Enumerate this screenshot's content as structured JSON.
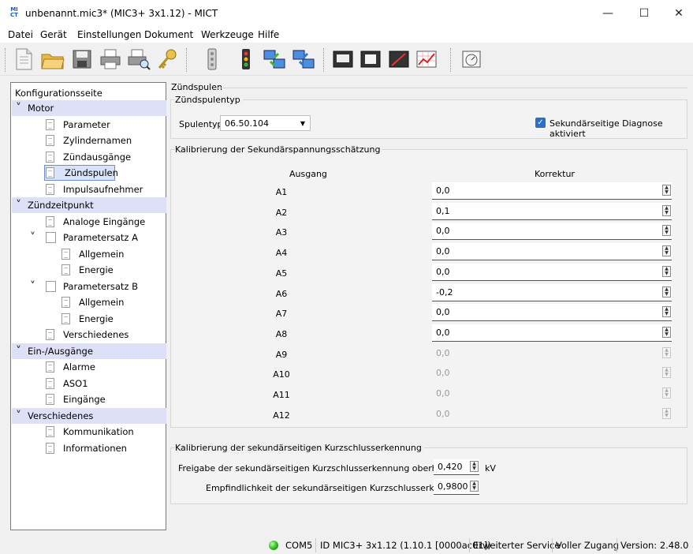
{
  "window": {
    "app_icon_text": "MI CT",
    "title": "unbenannt.mic3* (MIC3+ 3x1.12) - MICT",
    "minimize_glyph": "—",
    "maximize_glyph": "☐",
    "close_glyph": "✕"
  },
  "menu": [
    "Datei",
    "Gerät",
    "Einstellungen",
    "Dokument",
    "Werkzeuge",
    "Hilfe"
  ],
  "toolbar": {
    "buttons": [
      "new-document",
      "open-folder",
      "save",
      "print",
      "print-preview",
      "key",
      "device-off",
      "traffic-light",
      "transfer-to-device",
      "transfer-from-device",
      "monitor",
      "display",
      "recorder",
      "chart",
      "gauge"
    ]
  },
  "tree": {
    "header": "Konfigurationsseite",
    "items": [
      {
        "label": "Motor",
        "level": 0,
        "category": true
      },
      {
        "label": "Parameter",
        "level": 1
      },
      {
        "label": "Zylindernamen",
        "level": 1
      },
      {
        "label": "Zündausgänge",
        "level": 1
      },
      {
        "label": "Zündspulen",
        "level": 1,
        "selected": true
      },
      {
        "label": "Impulsaufnehmer",
        "level": 1
      },
      {
        "label": "Zündzeitpunkt",
        "level": 0,
        "category": true
      },
      {
        "label": "Analoge Eingänge",
        "level": 1
      },
      {
        "label": "Parametersatz A",
        "level": 1,
        "expandable": true
      },
      {
        "label": "Allgemein",
        "level": 2
      },
      {
        "label": "Energie",
        "level": 2
      },
      {
        "label": "Parametersatz B",
        "level": 1,
        "expandable": true
      },
      {
        "label": "Allgemein",
        "level": 2
      },
      {
        "label": "Energie",
        "level": 2
      },
      {
        "label": "Verschiedenes",
        "level": 1
      },
      {
        "label": "Ein-/Ausgänge",
        "level": 0,
        "category": true
      },
      {
        "label": "Alarme",
        "level": 1
      },
      {
        "label": "ASO1",
        "level": 1
      },
      {
        "label": "Eingänge",
        "level": 1
      },
      {
        "label": "Verschiedenes",
        "level": 0,
        "category": true
      },
      {
        "label": "Kommunikation",
        "level": 1
      },
      {
        "label": "Informationen",
        "level": 1
      }
    ]
  },
  "main": {
    "title": "Zündspulen",
    "coil_type_group": {
      "title": "Zündspulentyp",
      "label": "Spulentyp:",
      "value": "06.50.104",
      "diagnose_label": "Sekundärseitige Diagnose aktiviert",
      "diagnose_checked": true
    },
    "calibration_group": {
      "title": "Kalibrierung der Sekundärspannungsschätzung",
      "col_output": "Ausgang",
      "col_correction": "Korrektur",
      "rows": [
        {
          "output": "A1",
          "value": "0,0",
          "enabled": true
        },
        {
          "output": "A2",
          "value": "0,1",
          "enabled": true
        },
        {
          "output": "A3",
          "value": "0,0",
          "enabled": true
        },
        {
          "output": "A4",
          "value": "0,0",
          "enabled": true
        },
        {
          "output": "A5",
          "value": "0,0",
          "enabled": true
        },
        {
          "output": "A6",
          "value": "-0,2",
          "enabled": true
        },
        {
          "output": "A7",
          "value": "0,0",
          "enabled": true
        },
        {
          "output": "A8",
          "value": "0,0",
          "enabled": true
        },
        {
          "output": "A9",
          "value": "0,0",
          "enabled": false
        },
        {
          "output": "A10",
          "value": "0,0",
          "enabled": false
        },
        {
          "output": "A11",
          "value": "0,0",
          "enabled": false
        },
        {
          "output": "A12",
          "value": "0,0",
          "enabled": false
        }
      ]
    },
    "short_circuit_group": {
      "title": "Kalibrierung der sekundärseitigen Kurzschlusserkennung",
      "threshold_label": "Freigabe der sekundärseitigen Kurzschlusserkennung oberhalb von:",
      "threshold_value": "0,420",
      "threshold_unit": "kV",
      "sensitivity_label": "Empfindlichkeit der sekundärseitigen Kurzschlusserkennung:",
      "sensitivity_value": "0,9800"
    }
  },
  "statusbar": {
    "port": "COM5",
    "device_id": "ID MIC3+ 3x1.12 (1.10.1 [0000ac01])",
    "service": "Erweiterter Service",
    "access": "Voller Zugang",
    "version": "Version: 2.48.0"
  },
  "colors": {
    "category_bg": "#dde0f6",
    "selected_border": "#6b8fd6",
    "checkbox": "#2a6fc9",
    "led": "#2db51f"
  }
}
